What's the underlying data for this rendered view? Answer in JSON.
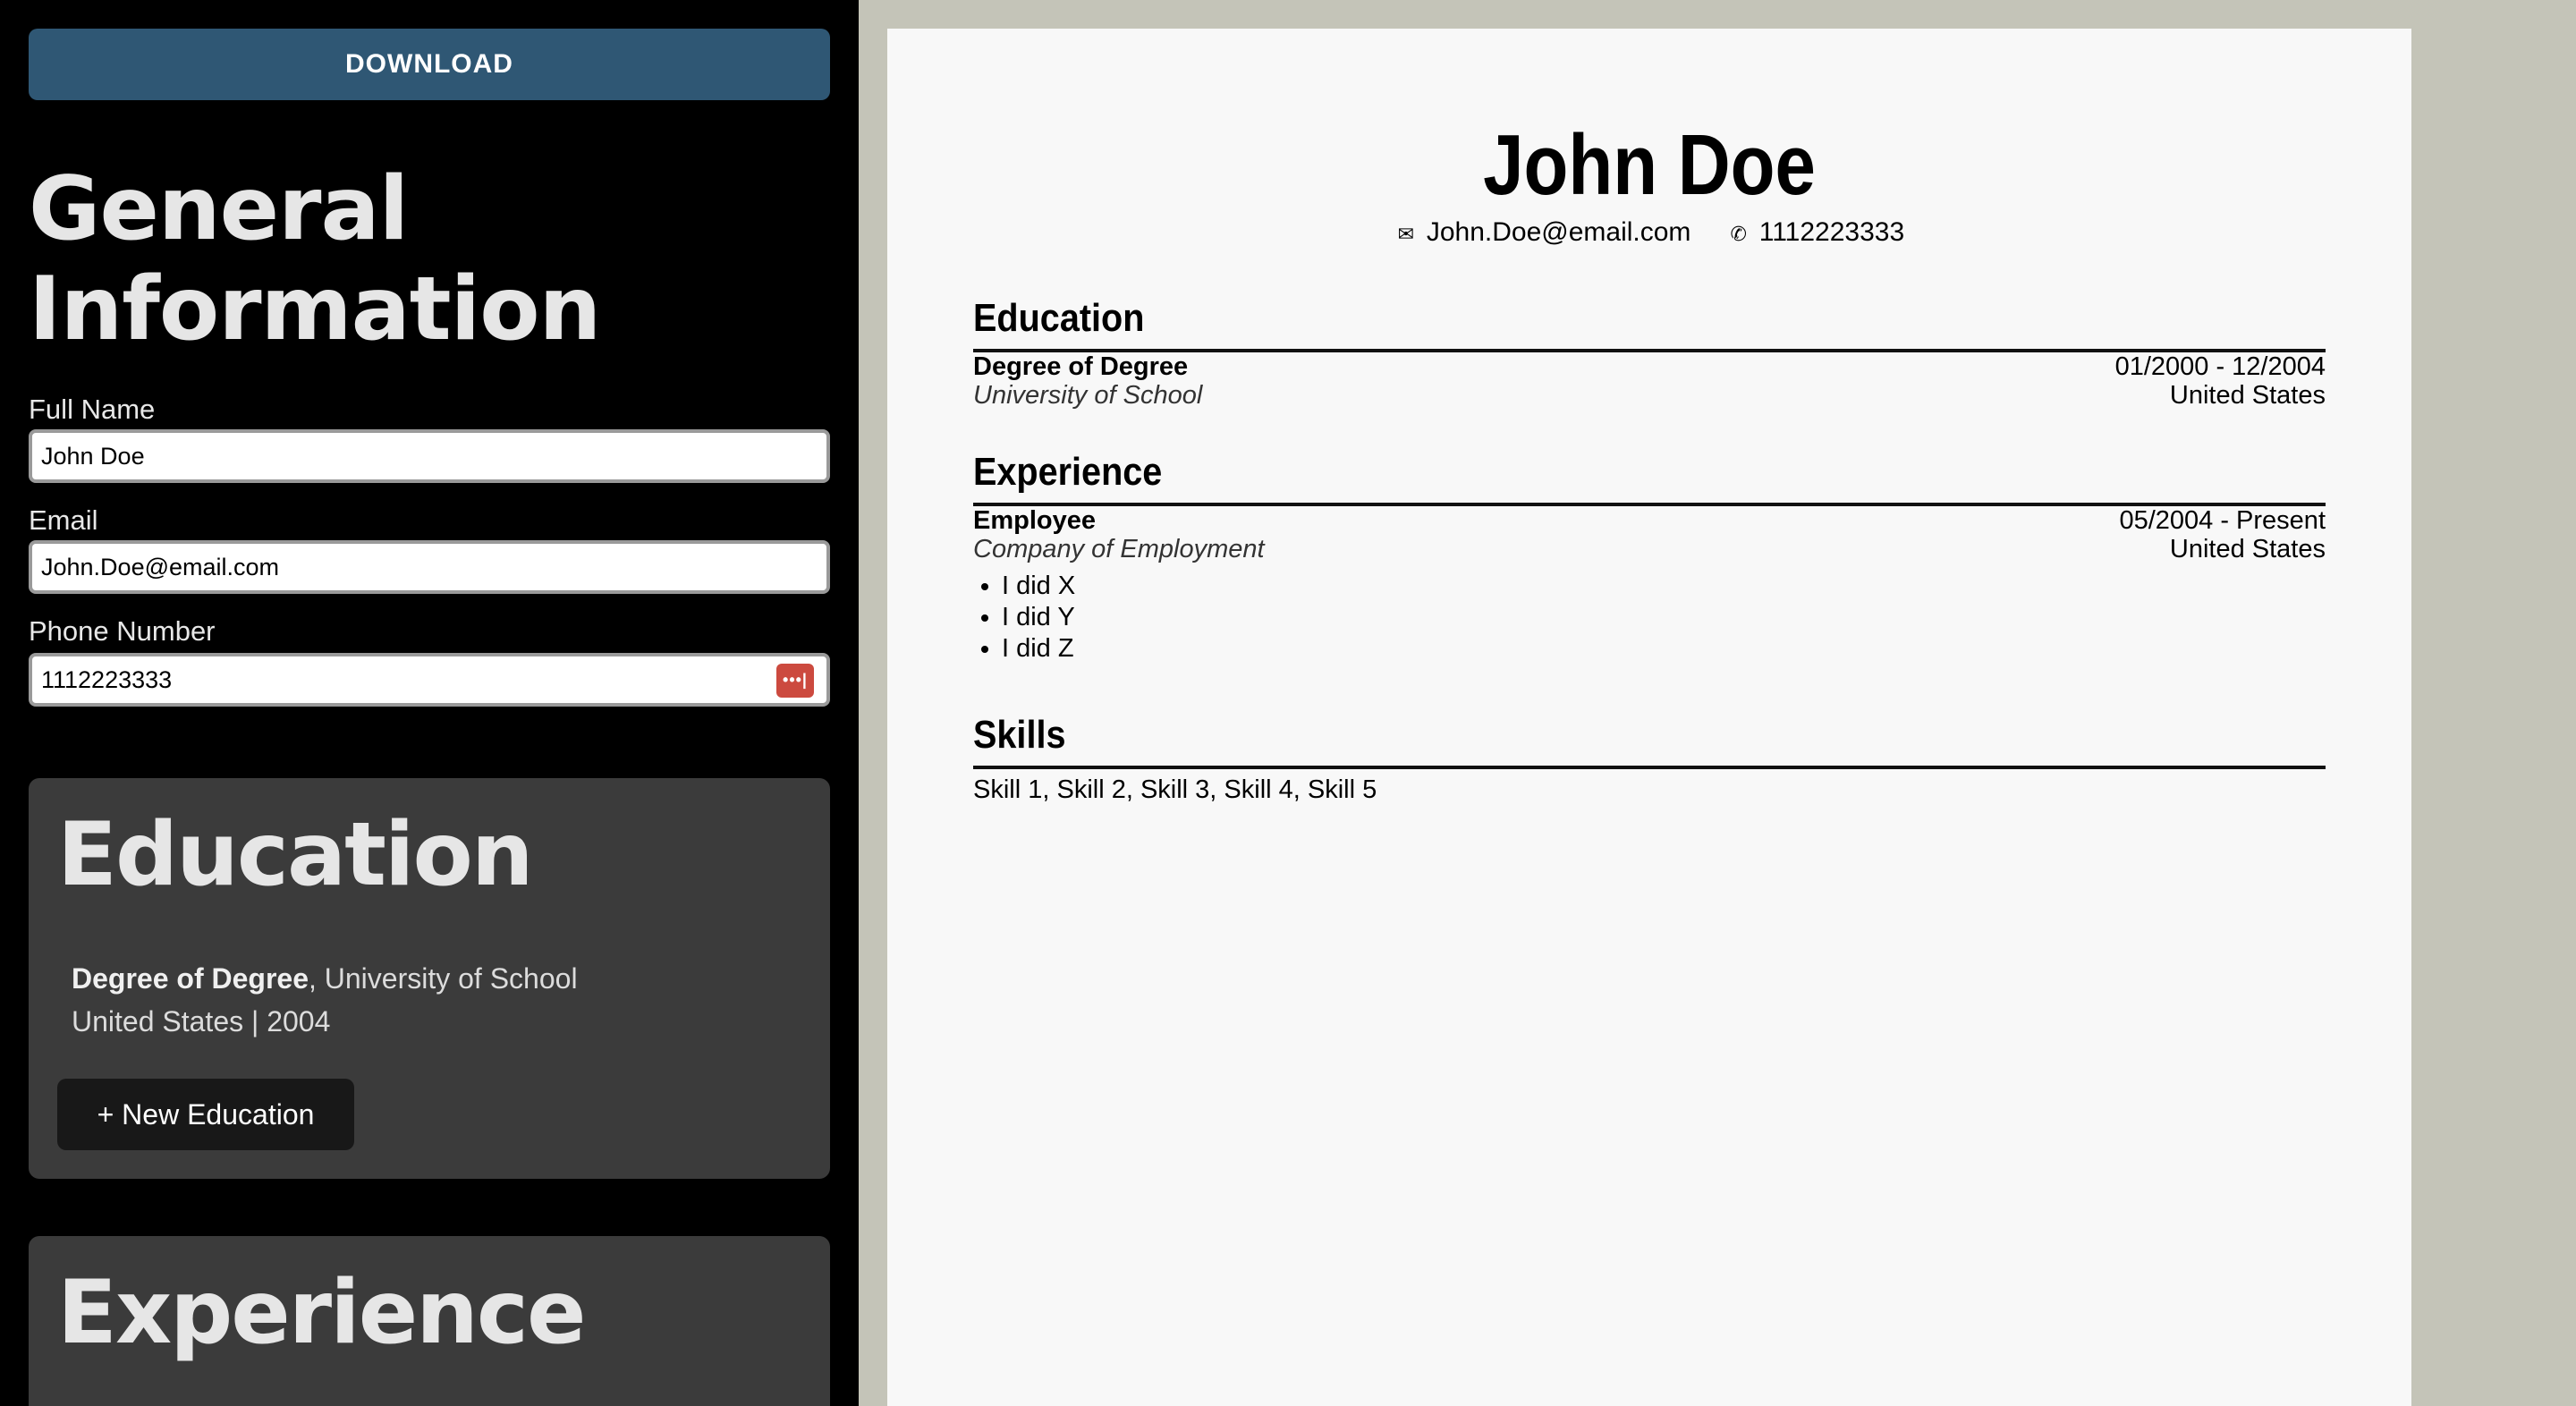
{
  "editor": {
    "download_label": "DOWNLOAD",
    "general_title": "General Information",
    "fields": {
      "full_name_label": "Full Name",
      "full_name_value": "John Doe",
      "email_label": "Email",
      "email_value": "John.Doe@email.com",
      "phone_label": "Phone Number",
      "phone_value": "1112223333"
    },
    "password_manager_icon": "password-manager-icon",
    "education": {
      "title": "Education",
      "entry_degree": "Degree of Degree",
      "entry_school": ", University of School",
      "entry_meta": "United States | 2004",
      "new_button": "+ New Education"
    },
    "experience": {
      "title": "Experience"
    }
  },
  "resume": {
    "name": "John Doe",
    "email": "John.Doe@email.com",
    "phone": "1112223333",
    "email_icon": "envelope-icon",
    "phone_icon": "phone-icon",
    "education": {
      "title": "Education",
      "degree": "Degree of Degree",
      "dates": "01/2000 - 12/2004",
      "school": "University of School",
      "location": "United States"
    },
    "experience": {
      "title": "Experience",
      "position": "Employee",
      "dates": "05/2004 - Present",
      "company": "Company of Employment",
      "location": "United States",
      "bullets": [
        "I did X",
        "I did Y",
        "I did Z"
      ]
    },
    "skills": {
      "title": "Skills",
      "list": "Skill 1, Skill 2, Skill 3, Skill 4, Skill 5"
    }
  },
  "colors": {
    "page_background": "#c4c4b8",
    "editor_background": "#000000",
    "download_button": "#2f5774",
    "card_background": "#3b3b3b",
    "resume_paper": "#f8f8f8",
    "password_icon": "#cc4a3f"
  }
}
